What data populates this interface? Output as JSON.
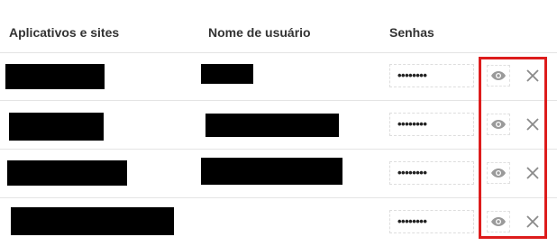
{
  "table": {
    "headers": {
      "site": "Aplicativos e sites",
      "user": "Nome de usuário",
      "password": "Senhas"
    },
    "rows": [
      {
        "password_mask": "••••••••"
      },
      {
        "password_mask": "••••••••"
      },
      {
        "password_mask": "••••••••"
      },
      {
        "password_mask": "••••••••"
      }
    ]
  },
  "icons": {
    "show_password": "eye-icon",
    "remove": "close-icon"
  },
  "colors": {
    "highlight": "#dd1c1c",
    "icon": "#9a9a9a",
    "redaction": "#000000"
  }
}
